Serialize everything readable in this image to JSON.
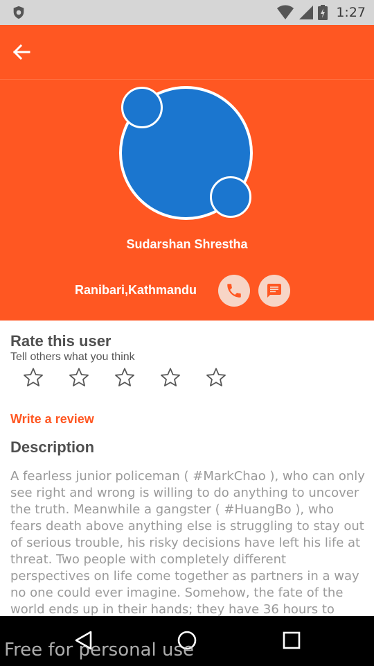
{
  "status_bar": {
    "time": "1:27",
    "left_icon": "shield-icon",
    "right_icons": [
      "wifi-icon",
      "signal-icon",
      "battery-icon"
    ]
  },
  "toolbar": {
    "back_icon": "arrow-back-icon"
  },
  "profile": {
    "name": "Sudarshan Shrestha",
    "location": "Ranibari,Kathmandu",
    "call_icon": "phone-icon",
    "message_icon": "message-icon"
  },
  "rating": {
    "title": "Rate this user",
    "subtitle": "Tell others what you think",
    "star_count": 5,
    "selected": 0
  },
  "review": {
    "write_label": "Write a review"
  },
  "description": {
    "title": "Description",
    "text": "A fearless junior policeman ( #MarkChao ), who can only see right and wrong is willing to do anything to uncover the truth. Meanwhile a gangster ( #HuangBo ), who fears death above anything else is struggling to stay out of serious trouble, his risky decisions have left his life at threat. Two people with completely different perspectives on life come together as partners in a way no one could ever imagine. Somehow, the fate of the world ends up in their hands; they have 36 hours to"
  },
  "nav_bar": {
    "icons": [
      "nav-back-icon",
      "nav-home-icon",
      "nav-recent-icon"
    ],
    "watermark": "Free for personal use"
  },
  "colors": {
    "accent": "#ff5722",
    "avatar": "#1b76cf",
    "button_bg": "#f7d5c6"
  }
}
